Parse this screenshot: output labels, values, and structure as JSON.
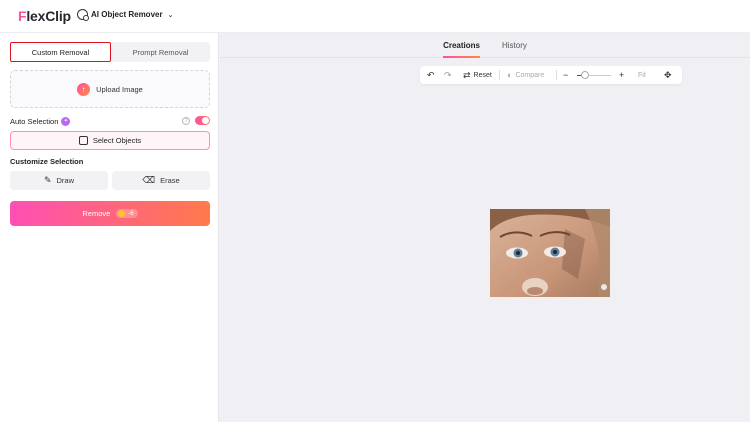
{
  "app": {
    "logo_first": "F",
    "logo_rest": "lexClip"
  },
  "header": {
    "tool_name": "AI Object Remover"
  },
  "left_panel": {
    "tabs": [
      {
        "label": "Custom Removal",
        "active": true
      },
      {
        "label": "Prompt Removal",
        "active": false
      }
    ],
    "upload_label": "Upload Image",
    "auto_selection": {
      "label": "Auto Selection",
      "enabled": true
    },
    "select_objects_label": "Select Objects",
    "customize_title": "Customize Selection",
    "draw_label": "Draw",
    "erase_label": "Erase",
    "remove_label": "Remove",
    "remove_cost": "-6"
  },
  "right_panel": {
    "tabs": [
      {
        "label": "Creations",
        "active": true
      },
      {
        "label": "History",
        "active": false
      }
    ],
    "toolbar": {
      "reset_label": "Reset",
      "compare_label": "Compare",
      "fit_label": "Fit",
      "zoom_level": 0.1
    }
  },
  "icons": {
    "undo": "undo-icon",
    "redo": "redo-icon",
    "reset": "reset-icon",
    "compare": "compare-icon",
    "zoom_out": "minus-icon",
    "zoom_in": "plus-icon",
    "move": "move-icon",
    "upload": "upload-icon",
    "draw": "pencil-icon",
    "erase": "eraser-icon"
  },
  "colors": {
    "accent_pink": "#ff4fa0",
    "accent_orange": "#ff8a3d",
    "highlight_red": "#e0141e"
  }
}
